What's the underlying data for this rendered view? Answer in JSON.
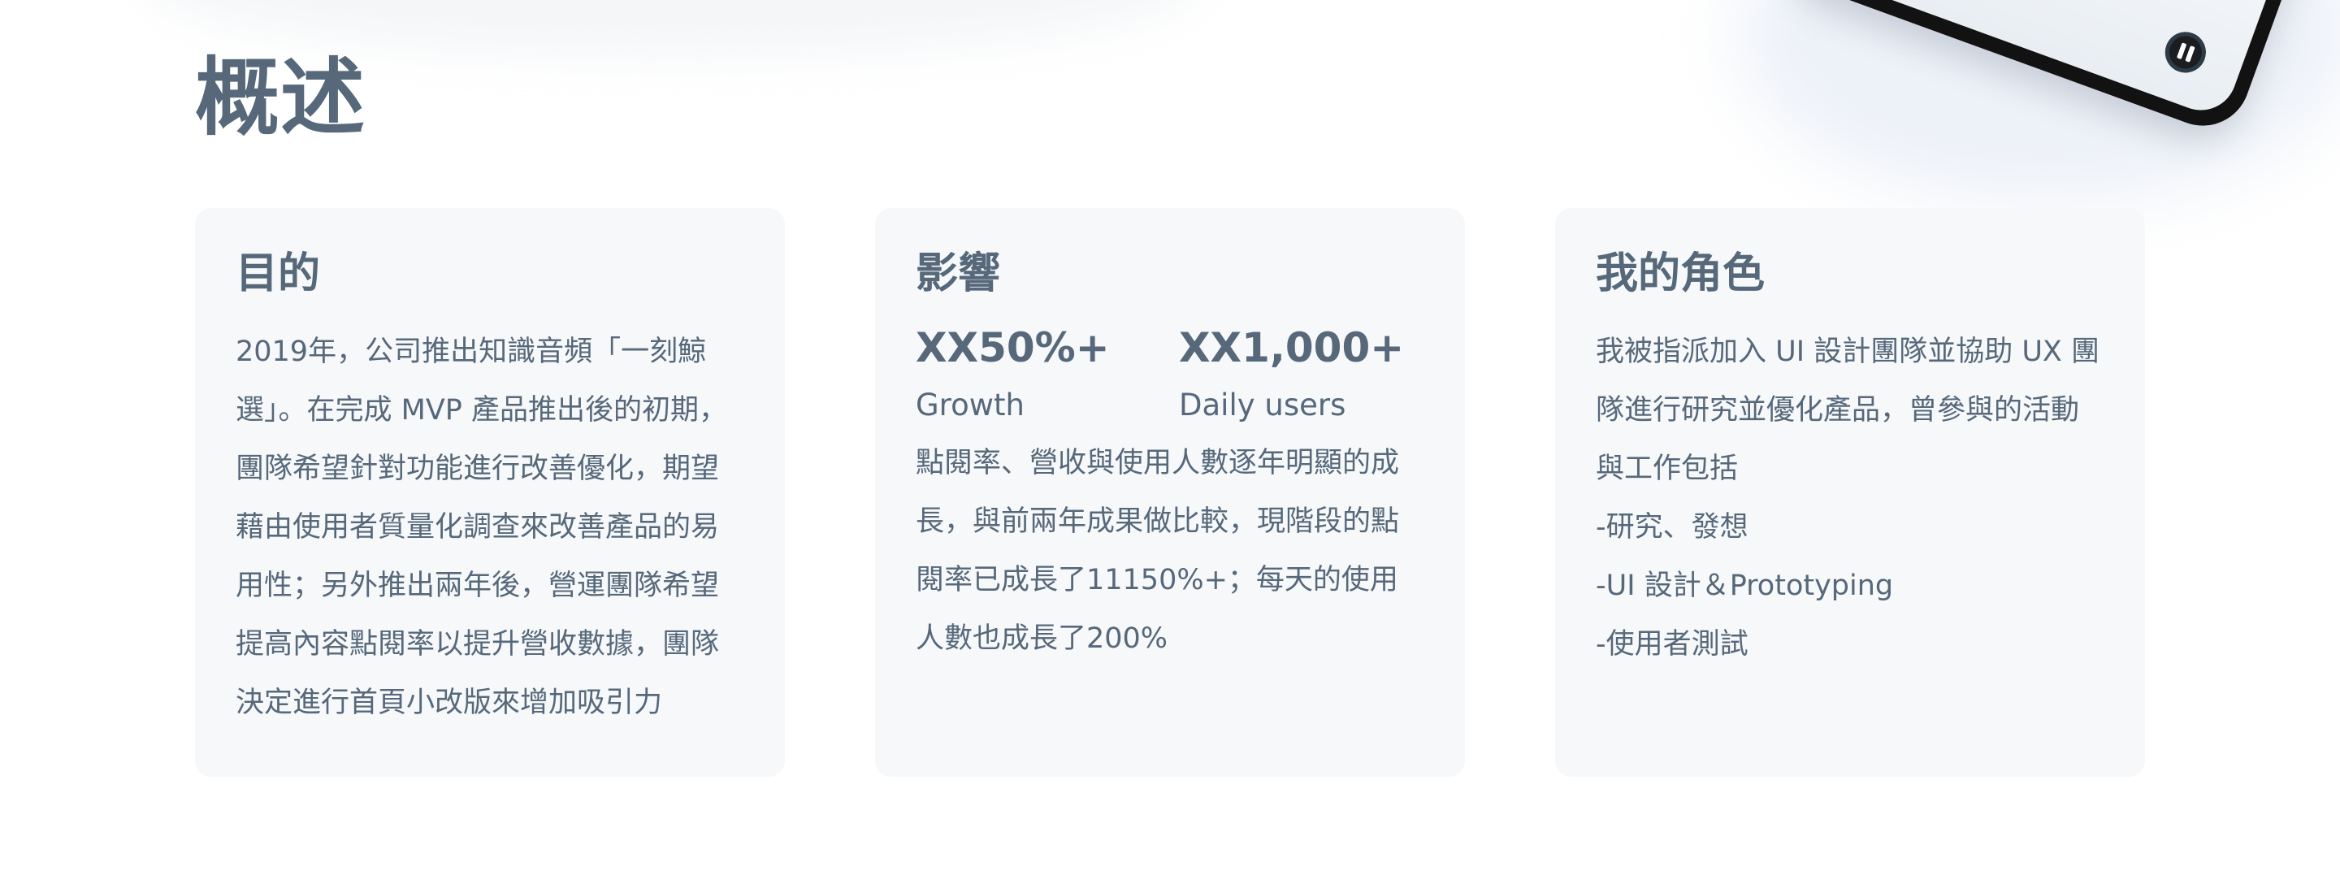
{
  "section": {
    "title": "概述"
  },
  "cards": {
    "purpose": {
      "title": "目的",
      "body": "2019年，公司推出知識音頻「一刻鯨選」。在完成 MVP 產品推出後的初期，團隊希望針對功能進行改善優化，期望藉由使用者質量化調查來改善產品的易用性；另外推出兩年後，營運團隊希望提高內容點閱率以提升營收數據，團隊決定進行首頁小改版來增加吸引力"
    },
    "impact": {
      "title": "影響",
      "metrics": [
        {
          "value": "XX50%+",
          "label": "Growth"
        },
        {
          "value": "XX1,000+",
          "label": "Daily users"
        }
      ],
      "body": "點閱率、營收與使用人數逐年明顯的成長，與前兩年成果做比較，現階段的點閱率已成長了11150%+；每天的使用人數也成長了200%"
    },
    "role": {
      "title": "我的角色",
      "intro": "我被指派加入 UI 設計團隊並協助 UX 團隊進行研究並優化產品，曾參與的活動與工作包括",
      "items": [
        "-研究、發想",
        "-UI 設計＆Prototyping",
        "-使用者測試"
      ]
    }
  },
  "phone": {
    "icon": "pause-icon",
    "accent": "#121212"
  }
}
